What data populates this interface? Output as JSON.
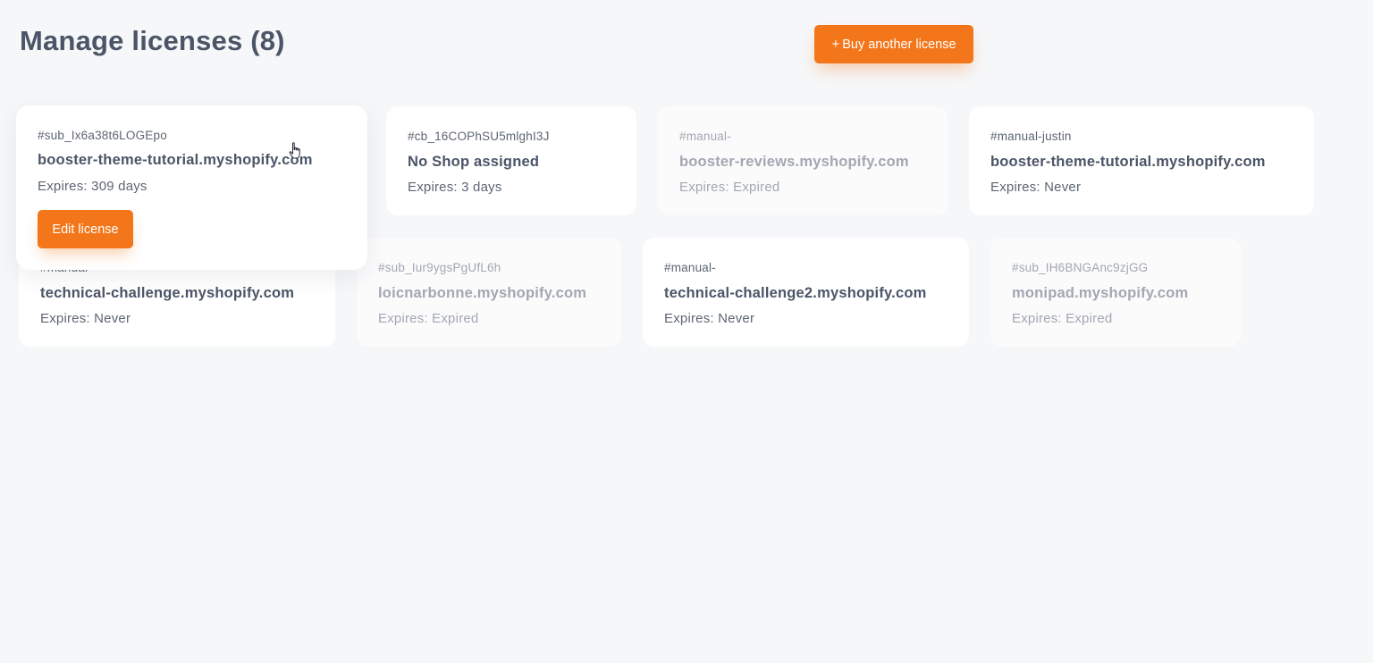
{
  "header": {
    "title": "Manage licenses (8)",
    "buy_button": {
      "icon": "plus-icon",
      "plus": "+",
      "label": "Buy another license"
    }
  },
  "licenses": [
    {
      "id": "#sub_Ix6a38t6LOGEpo",
      "shop": "booster-theme-tutorial.myshopify.com",
      "expires": "Expires: 309 days",
      "status": "active",
      "edit_label": "Edit license"
    },
    {
      "id": "#cb_16COPhSU5mlghI3J",
      "shop": "No Shop assigned",
      "expires": "Expires: 3 days",
      "status": "active"
    },
    {
      "id": "#manual-",
      "shop": "booster-reviews.myshopify.com",
      "expires": "Expires: Expired",
      "status": "expired"
    },
    {
      "id": "#manual-justin",
      "shop": "booster-theme-tutorial.myshopify.com",
      "expires": "Expires: Never",
      "status": "active"
    },
    {
      "id": "#manual-",
      "shop": "technical-challenge.myshopify.com",
      "expires": "Expires: Never",
      "status": "active"
    },
    {
      "id": "#sub_Iur9ygsPgUfL6h",
      "shop": "loicnarbonne.myshopify.com",
      "expires": "Expires: Expired",
      "status": "expired"
    },
    {
      "id": "#manual-",
      "shop": "technical-challenge2.myshopify.com",
      "expires": "Expires: Never",
      "status": "active"
    },
    {
      "id": "#sub_IH6BNGAnc9zjGG",
      "shop": "monipad.myshopify.com",
      "expires": "Expires: Expired",
      "status": "expired"
    }
  ],
  "colors": {
    "accent": "#f3761a",
    "background": "#f6f7f9",
    "text_primary": "#4b5567",
    "text_muted": "#a2a7b1"
  },
  "cursor": {
    "icon": "hand-pointer-icon"
  }
}
